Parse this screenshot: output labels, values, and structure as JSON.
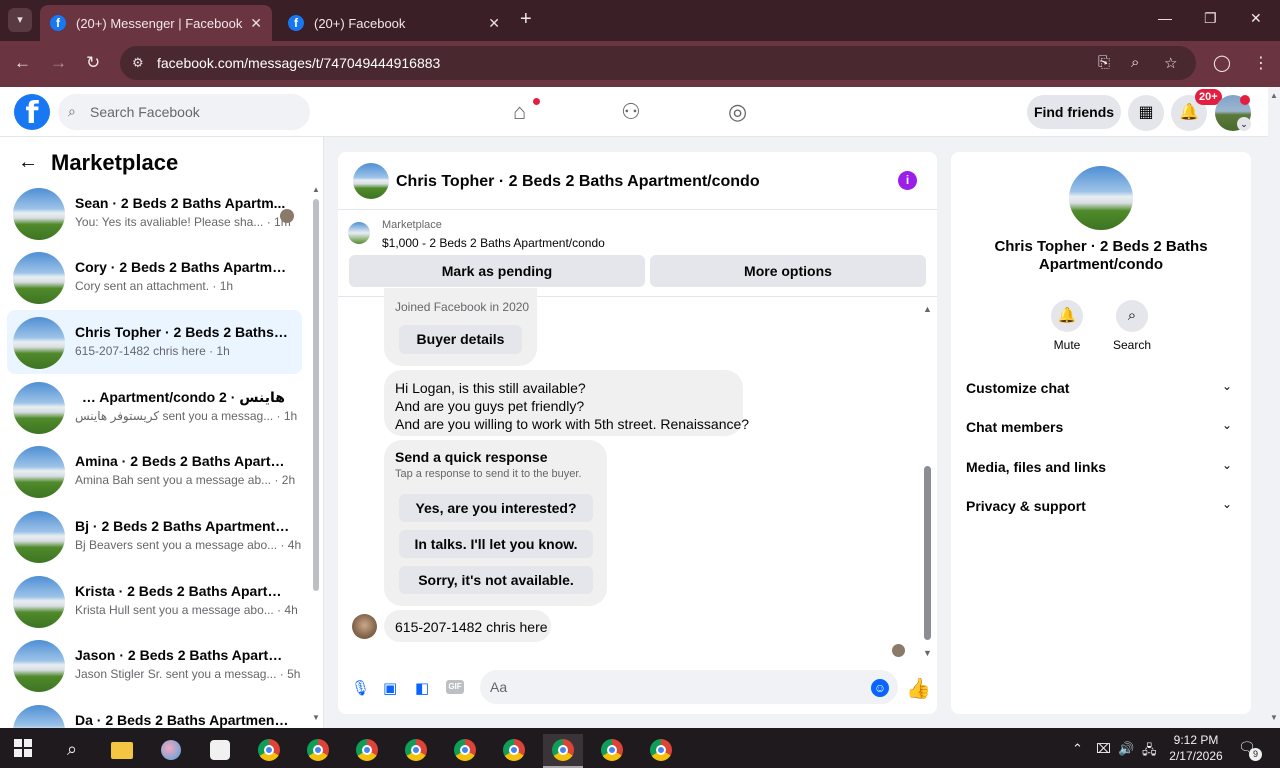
{
  "browser": {
    "tabs": [
      {
        "title": "(20+) Messenger | Facebook",
        "close": "✕",
        "favicon": "f"
      },
      {
        "title": "(20+) Facebook",
        "close": "✕",
        "favicon": "f"
      }
    ],
    "tab_search_icon": "chevron-down-icon",
    "new_tab": "+",
    "window_controls": {
      "minimize": "—",
      "restore": "❐",
      "close": "✕"
    },
    "nav": {
      "back": "←",
      "forward": "→",
      "reload": "↻"
    },
    "url": "facebook.com/messages/t/747049444916883",
    "site_info_icon": "⚙",
    "omni_icons": {
      "install": "⎘",
      "zoom": "⌕",
      "bookmark": "☆"
    },
    "profile_icon": "◯",
    "menu_icon": "⋮"
  },
  "fb_nav": {
    "logo": "f",
    "search_placeholder": "Search Facebook",
    "search_icon": "⌕",
    "home_icon": "⌂",
    "friends_icon": "⚇",
    "groups_icon": "◎",
    "find_friends": "Find friends",
    "menu_icon": "▦",
    "notif_icon": "🔔",
    "notif_badge": "20+",
    "avatar_chevron": "⌄"
  },
  "sidebar": {
    "back_icon": "←",
    "title": "Marketplace",
    "conversations": [
      {
        "title": "Sean · 2 Beds 2 Baths Apartm...",
        "subtitle": "You: Yes its avaliable! Please sha... · 1m",
        "selected": false,
        "seen": true
      },
      {
        "title": "Cory · 2 Beds 2 Baths Apartmen...",
        "subtitle": "Cory sent an attachment. · 1h",
        "selected": false,
        "seen": false
      },
      {
        "title": "Chris Topher · 2 Beds 2 Baths Ap...",
        "subtitle": "615-207-1482 chris here · 1h",
        "selected": true,
        "seen": false
      },
      {
        "title": "هاينس · 2 Beds 2 Baths Apartment/condo...",
        "subtitle": "كريستوفر هاينس sent you a messag... · 1h",
        "selected": false,
        "seen": false
      },
      {
        "title": "Amina · 2 Beds 2 Baths Apartme...",
        "subtitle": "Amina Bah sent you a message ab... · 2h",
        "selected": false,
        "seen": false
      },
      {
        "title": "Bj · 2 Beds 2 Baths Apartment/c...",
        "subtitle": "Bj Beavers sent you a message abo... · 4h",
        "selected": false,
        "seen": false
      },
      {
        "title": "Krista · 2 Beds 2 Baths Apartme...",
        "subtitle": "Krista Hull sent you a message abo... · 4h",
        "selected": false,
        "seen": false
      },
      {
        "title": "Jason · 2 Beds 2 Baths Apartme...",
        "subtitle": "Jason Stigler Sr. sent you a messag... · 5h",
        "selected": false,
        "seen": false
      },
      {
        "title": "Da · 2 Beds 2 Baths Apartment/...",
        "subtitle": "",
        "selected": false,
        "seen": false
      }
    ],
    "scroll_up": "▲",
    "scroll_down": "▼"
  },
  "chat": {
    "title": "Chris Topher · 2 Beds 2 Baths Apartment/condo",
    "info_icon": "i",
    "listing_label": "Marketplace",
    "listing_price": "$1,000 - 2 Beds 2 Baths Apartment/condo",
    "mark_pending": "Mark as pending",
    "more_options": "More options",
    "joined": "Joined Facebook in 2020",
    "buyer_details": "Buyer details",
    "question_lines": [
      "Hi Logan, is this still available?",
      "And are you guys pet friendly?",
      "And are you willing to work with 5th street. Renaissance?"
    ],
    "quick_response_title": "Send a quick response",
    "quick_response_sub": "Tap a response to send it to the buyer.",
    "quick_responses": [
      "Yes, are you interested?",
      "In talks. I'll let you know.",
      "Sorry, it's not available."
    ],
    "last_message": "615-207-1482 chris here",
    "composer_placeholder": "Aa",
    "composer_icons": {
      "mic": "🎙",
      "photo": "▣",
      "sticker": "◧",
      "gif": "GIF",
      "emoji": "☺",
      "like": "👍"
    },
    "scroll_up": "▲",
    "scroll_down": "▼"
  },
  "info_panel": {
    "name": "Chris Topher · 2 Beds 2 Baths Apartment/condo",
    "actions": [
      {
        "label": "Mute",
        "icon": "🔔"
      },
      {
        "label": "Search",
        "icon": "⌕"
      }
    ],
    "rows": [
      "Customize chat",
      "Chat members",
      "Media, files and links",
      "Privacy & support"
    ],
    "chevron": "⌄"
  },
  "taskbar": {
    "search_icon": "⌕",
    "time": "9:12 PM",
    "date": "2/17/2026",
    "tray_icons": {
      "chevron": "⌃",
      "meet": "⌧",
      "volume": "🔊",
      "network": "🖧"
    },
    "notif_icon": "🗨",
    "notif_count": "9"
  }
}
